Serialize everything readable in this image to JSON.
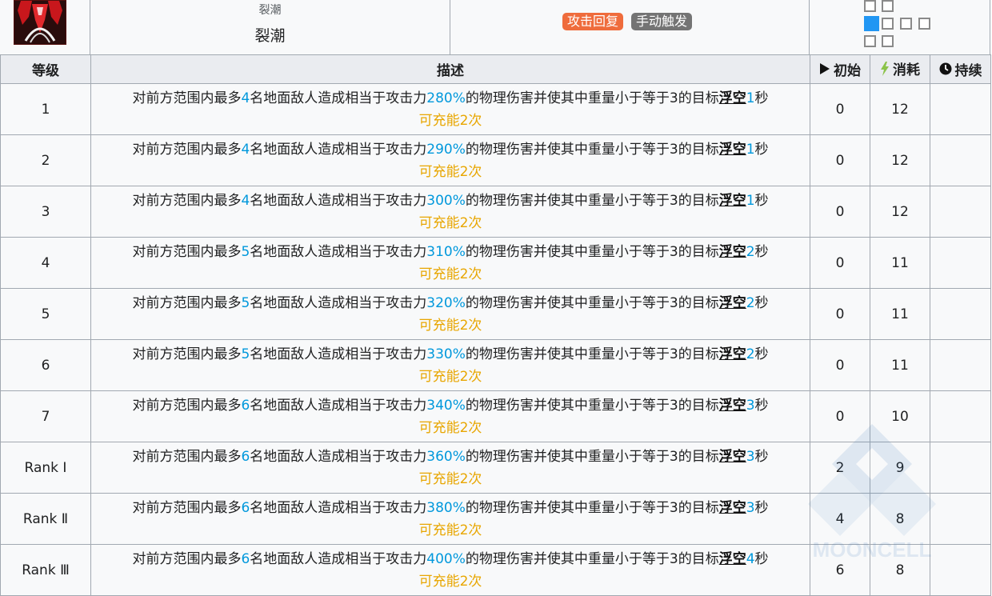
{
  "skill": {
    "name_small": "裂潮",
    "name": "裂潮",
    "tags": [
      "攻击回复",
      "手动触发"
    ]
  },
  "table": {
    "headers": {
      "level": "等级",
      "description": "描述",
      "initial": "初始",
      "cost": "消耗",
      "duration": "持续"
    },
    "desc_template": {
      "p1": "对前方范围内最多",
      "p2": "名地面敌人造成相当于攻击力",
      "p3": "的物理伤害并使其中重量小于等于3的目标",
      "airborne": "浮空",
      "sec": "秒",
      "charges": "可充能2次"
    },
    "rows": [
      {
        "level": "1",
        "targets": "4",
        "atk": "280%",
        "time": "1",
        "initial": "0",
        "cost": "12",
        "duration": ""
      },
      {
        "level": "2",
        "targets": "4",
        "atk": "290%",
        "time": "1",
        "initial": "0",
        "cost": "12",
        "duration": ""
      },
      {
        "level": "3",
        "targets": "4",
        "atk": "300%",
        "time": "1",
        "initial": "0",
        "cost": "12",
        "duration": ""
      },
      {
        "level": "4",
        "targets": "5",
        "atk": "310%",
        "time": "2",
        "initial": "0",
        "cost": "11",
        "duration": ""
      },
      {
        "level": "5",
        "targets": "5",
        "atk": "320%",
        "time": "2",
        "initial": "0",
        "cost": "11",
        "duration": ""
      },
      {
        "level": "6",
        "targets": "5",
        "atk": "330%",
        "time": "2",
        "initial": "0",
        "cost": "11",
        "duration": ""
      },
      {
        "level": "7",
        "targets": "6",
        "atk": "340%",
        "time": "3",
        "initial": "0",
        "cost": "10",
        "duration": ""
      },
      {
        "level": "Rank Ⅰ",
        "targets": "6",
        "atk": "360%",
        "time": "3",
        "initial": "2",
        "cost": "9",
        "duration": ""
      },
      {
        "level": "Rank Ⅱ",
        "targets": "6",
        "atk": "380%",
        "time": "3",
        "initial": "4",
        "cost": "8",
        "duration": ""
      },
      {
        "level": "Rank Ⅲ",
        "targets": "6",
        "atk": "400%",
        "time": "4",
        "initial": "6",
        "cost": "8",
        "duration": ""
      }
    ]
  },
  "watermark": "MOONCELL",
  "colors": {
    "number": "#0098dc",
    "charges": "#e8a600",
    "tag_recover": "#ef6c3c",
    "tag_trigger": "#747474",
    "range_self": "#2196f3",
    "sp_icon": "#8bc34a"
  }
}
